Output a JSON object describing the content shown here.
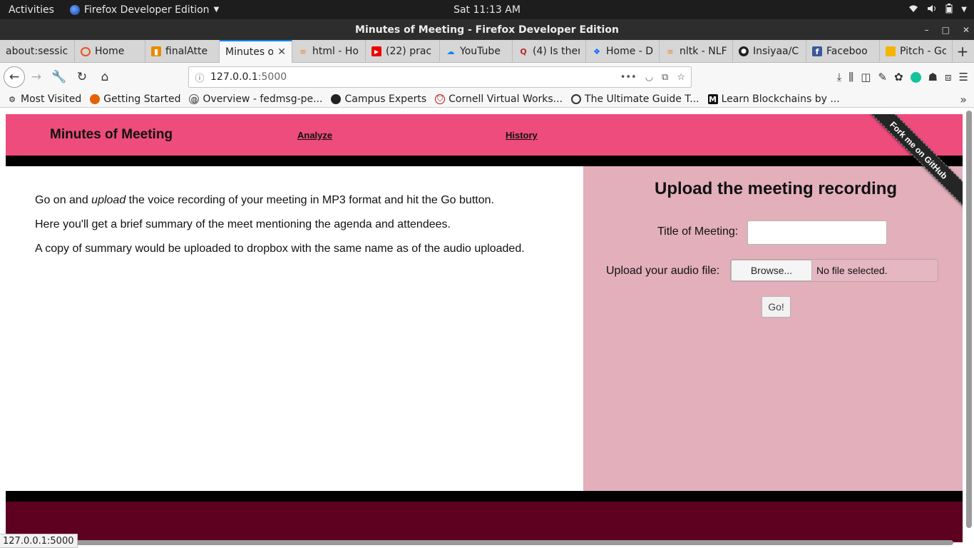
{
  "system": {
    "activities": "Activities",
    "app_name": "Firefox Developer Edition",
    "clock": "Sat 11:13 AM"
  },
  "window": {
    "title": "Minutes of Meeting - Firefox Developer Edition"
  },
  "tabs": [
    {
      "label": "about:sessic",
      "icon": "blank-icon"
    },
    {
      "label": "Home",
      "icon": "ubuntu-icon"
    },
    {
      "label": "finalAtte",
      "icon": "doc-icon"
    },
    {
      "label": "Minutes o",
      "icon": "none",
      "active": true
    },
    {
      "label": "html - Ho",
      "icon": "stackoverflow-icon"
    },
    {
      "label": "(22) prac",
      "icon": "youtube-icon"
    },
    {
      "label": "YouTube",
      "icon": "download-cloud-icon"
    },
    {
      "label": "(4) Is ther",
      "icon": "quora-icon"
    },
    {
      "label": "Home - D",
      "icon": "dropbox-icon"
    },
    {
      "label": "nltk - NLF",
      "icon": "stackoverflow-icon"
    },
    {
      "label": "Insiyaa/C",
      "icon": "github-icon"
    },
    {
      "label": "Faceboo",
      "icon": "facebook-icon"
    },
    {
      "label": "Pitch - Gc",
      "icon": "slides-icon"
    }
  ],
  "url": {
    "host": "127.0.0.1",
    "port": ":5000"
  },
  "bookmarks": [
    {
      "label": "Most Visited",
      "icon": "gear-icon"
    },
    {
      "label": "Getting Started",
      "icon": "firefox-icon"
    },
    {
      "label": "Overview - fedmsg-pe...",
      "icon": "globe-icon"
    },
    {
      "label": "Campus Experts",
      "icon": "github-icon"
    },
    {
      "label": "Cornell Virtual Works...",
      "icon": "shield-icon"
    },
    {
      "label": "The Ultimate Guide T...",
      "icon": "globe-icon"
    },
    {
      "label": "Learn Blockchains by ...",
      "icon": "medium-icon"
    }
  ],
  "site": {
    "title": "Minutes of Meeting",
    "nav": {
      "analyze": "Analyze",
      "history": "History"
    },
    "ribbon": "Fork me on GitHub",
    "intro": {
      "line1_before": "Go on and ",
      "line1_em": "upload",
      "line1_after": " the voice recording of your meeting in MP3 format and hit the Go button.",
      "line2": "Here you'll get a brief summary of the meet mentioning the agenda and attendees.",
      "line3": "A copy of summary would be uploaded to dropbox with the same name as of the audio uploaded."
    },
    "form": {
      "heading": "Upload the meeting recording",
      "title_label": "Title of Meeting:",
      "title_value": "",
      "file_label": "Upload your audio file:",
      "browse_label": "Browse...",
      "file_status": "No file selected.",
      "go_label": "Go!"
    },
    "colors": {
      "header": "#ee4c7c",
      "side_panel": "#e2afbb",
      "footer": "#5e001f"
    }
  },
  "status_url": "127.0.0.1:5000"
}
